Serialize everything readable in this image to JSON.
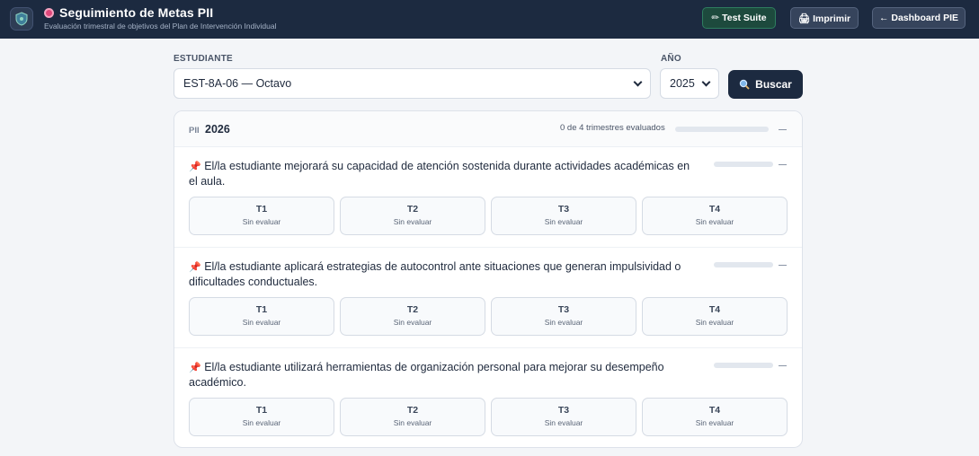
{
  "header": {
    "title": "Seguimiento de Metas PII",
    "subtitle": "Evaluación trimestral de objetivos del Plan de Intervención Individual",
    "buttons": {
      "test": "✏ Test Suite",
      "print": "🖨 Imprimir",
      "dashboard": "← Dashboard PIE"
    }
  },
  "filters": {
    "student_label": "ESTUDIANTE",
    "student_value": "EST-8A-06 — Octavo",
    "year_label": "AÑO",
    "year_value": "2025",
    "search_label": "Buscar"
  },
  "pii": {
    "tag": "PII",
    "year": "2026",
    "progress_text": "0 de 4 trimestres evaluados",
    "progress_fraction": 0,
    "goals": [
      {
        "text": "El/la estudiante mejorará su capacidad de atención sostenida durante actividades académicas en el aula.",
        "progress_fraction": 0,
        "terms": [
          {
            "label": "T1",
            "status": "Sin evaluar"
          },
          {
            "label": "T2",
            "status": "Sin evaluar"
          },
          {
            "label": "T3",
            "status": "Sin evaluar"
          },
          {
            "label": "T4",
            "status": "Sin evaluar"
          }
        ]
      },
      {
        "text": "El/la estudiante aplicará estrategias de autocontrol ante situaciones que generan impulsividad o dificultades conductuales.",
        "progress_fraction": 0,
        "terms": [
          {
            "label": "T1",
            "status": "Sin evaluar"
          },
          {
            "label": "T2",
            "status": "Sin evaluar"
          },
          {
            "label": "T3",
            "status": "Sin evaluar"
          },
          {
            "label": "T4",
            "status": "Sin evaluar"
          }
        ]
      },
      {
        "text": "El/la estudiante utilizará herramientas de organización personal para mejorar su desempeño académico.",
        "progress_fraction": 0,
        "terms": [
          {
            "label": "T1",
            "status": "Sin evaluar"
          },
          {
            "label": "T2",
            "status": "Sin evaluar"
          },
          {
            "label": "T3",
            "status": "Sin evaluar"
          },
          {
            "label": "T4",
            "status": "Sin evaluar"
          }
        ]
      }
    ]
  },
  "icons": {
    "logo": "shield-icon",
    "title": "target-icon",
    "search": "magnifier-icon",
    "goal": "pin-icon"
  },
  "colors": {
    "header_bg": "#1c2a40",
    "test_button": "#1d4a3d",
    "accent_pin": "#d63b52"
  }
}
